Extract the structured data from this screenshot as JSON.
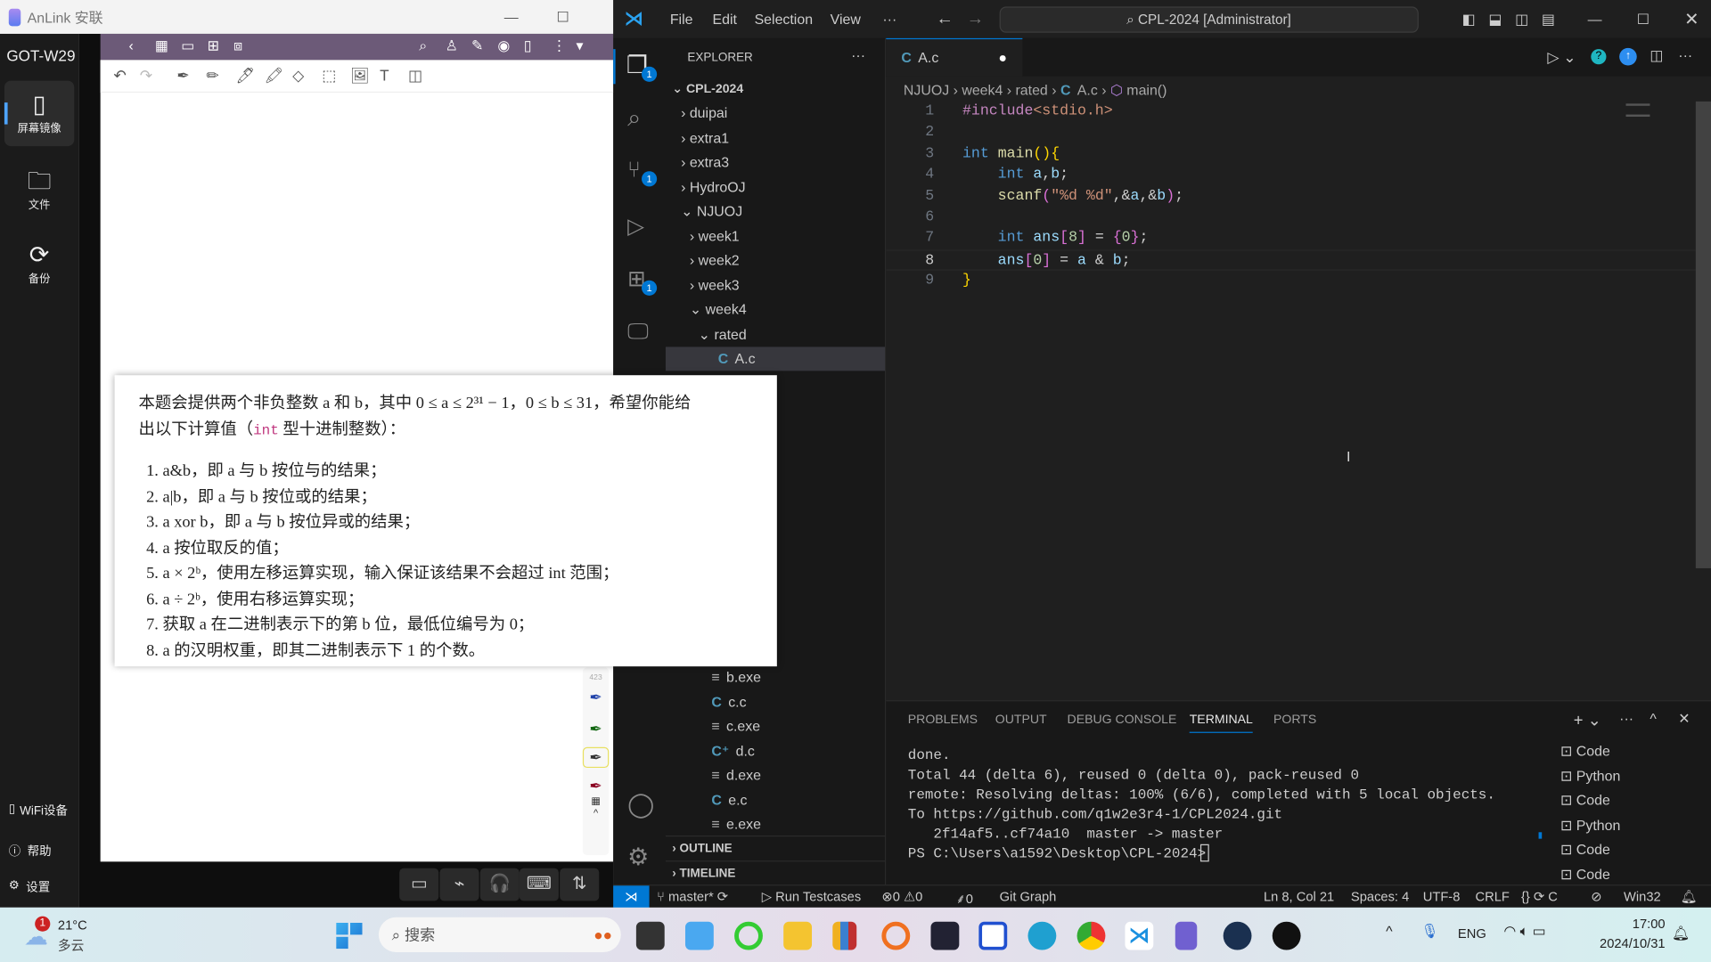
{
  "anlink": {
    "title": "AnLink 安联",
    "device": "GOT-W29",
    "side": [
      {
        "label": "屏幕镜像",
        "icon": "phone-icon"
      },
      {
        "label": "文件",
        "icon": "folder-icon"
      },
      {
        "label": "备份",
        "icon": "sync-icon"
      }
    ],
    "side_bottom": [
      {
        "label": "WiFi设备",
        "icon": "wifi-phone-icon"
      },
      {
        "label": "帮助",
        "icon": "help-icon"
      },
      {
        "label": "设置",
        "icon": "gear-icon"
      }
    ],
    "pen_size": "423"
  },
  "problem": {
    "intro": "本题会提供两个非负整数 a 和 b，其中 0 ≤ a ≤ 2³¹ − 1，0 ≤ b ≤ 31，希望你能给",
    "intro2_a": "出以下计算值（",
    "intro2_code": "int",
    "intro2_b": " 型十进制整数）：",
    "items": [
      "a&b，即 a 与 b 按位与的结果；",
      "a|b，即 a 与 b 按位或的结果；",
      "a xor b，即 a 与 b 按位异或的结果；",
      "a 按位取反的值；",
      "a × 2ᵇ，使用左移运算实现，输入保证该结果不会超过 int 范围；",
      "a ÷ 2ᵇ，使用右移运算实现；",
      "获取 a 在二进制表示下的第 b 位，最低位编号为 0；",
      "a 的汉明权重，即其二进制表示下 1 的个数。"
    ]
  },
  "vscode": {
    "menu": [
      "File",
      "Edit",
      "Selection",
      "View",
      "···"
    ],
    "search": "CPL-2024 [Administrator]",
    "explorer_title": "EXPLORER",
    "root": "CPL-2024",
    "tree": [
      {
        "label": "duipai",
        "type": "folder",
        "depth": 1
      },
      {
        "label": "extra1",
        "type": "folder",
        "depth": 1
      },
      {
        "label": "extra3",
        "type": "folder",
        "depth": 1
      },
      {
        "label": "HydroOJ",
        "type": "folder",
        "depth": 1
      },
      {
        "label": "NJUOJ",
        "type": "folder-open",
        "depth": 1
      },
      {
        "label": "week1",
        "type": "folder",
        "depth": 2
      },
      {
        "label": "week2",
        "type": "folder",
        "depth": 2
      },
      {
        "label": "week3",
        "type": "folder",
        "depth": 2
      },
      {
        "label": "week4",
        "type": "folder-open",
        "depth": 2
      },
      {
        "label": "rated",
        "type": "folder-open",
        "depth": 3
      },
      {
        "label": "A.c",
        "type": "c",
        "depth": 4,
        "selected": true
      }
    ],
    "tree_lower": [
      {
        "label": "b.exe",
        "type": "exe"
      },
      {
        "label": "c.c",
        "type": "c"
      },
      {
        "label": "c.exe",
        "type": "exe"
      },
      {
        "label": "d.c",
        "type": "cpp"
      },
      {
        "label": "d.exe",
        "type": "exe"
      },
      {
        "label": "e.c",
        "type": "c"
      },
      {
        "label": "e.exe",
        "type": "exe"
      }
    ],
    "outline": "OUTLINE",
    "timeline": "TIMELINE",
    "tab": "A.c",
    "breadcrumb": [
      "NJUOJ",
      "week4",
      "rated",
      "A.c",
      "main()"
    ],
    "current_line": 8,
    "panel_tabs": [
      "PROBLEMS",
      "OUTPUT",
      "DEBUG CONSOLE",
      "TERMINAL",
      "PORTS"
    ],
    "active_panel": "TERMINAL",
    "terminal": [
      "done.",
      "Total 44 (delta 6), reused 0 (delta 0), pack-reused 0",
      "remote: Resolving deltas: 100% (6/6), completed with 5 local objects.",
      "To https://github.com/q1w2e3r4-1/CPL2024.git",
      "   2f14af5..cf74a10  master -> master",
      "PS C:\\Users\\a1592\\Desktop\\CPL-2024> "
    ],
    "terminals": [
      "Code",
      "Python",
      "Code",
      "Python",
      "Code",
      "Code"
    ],
    "status": {
      "branch": "master*",
      "run": "Run Testcases",
      "errors": "0",
      "warnings": "0",
      "ports": "0",
      "git_graph": "Git Graph",
      "pos": "Ln 8, Col 21",
      "spaces": "Spaces: 4",
      "enc": "UTF-8",
      "eol": "CRLF",
      "lang": "C",
      "platform": "Win32"
    },
    "badges": {
      "explorer": "1",
      "scm": "1",
      "extensions": "1"
    }
  },
  "taskbar": {
    "temp": "21°C",
    "weather": "多云",
    "weather_badge": "1",
    "search": "搜索",
    "lang": "ENG",
    "time": "17:00",
    "date": "2024/10/31"
  }
}
